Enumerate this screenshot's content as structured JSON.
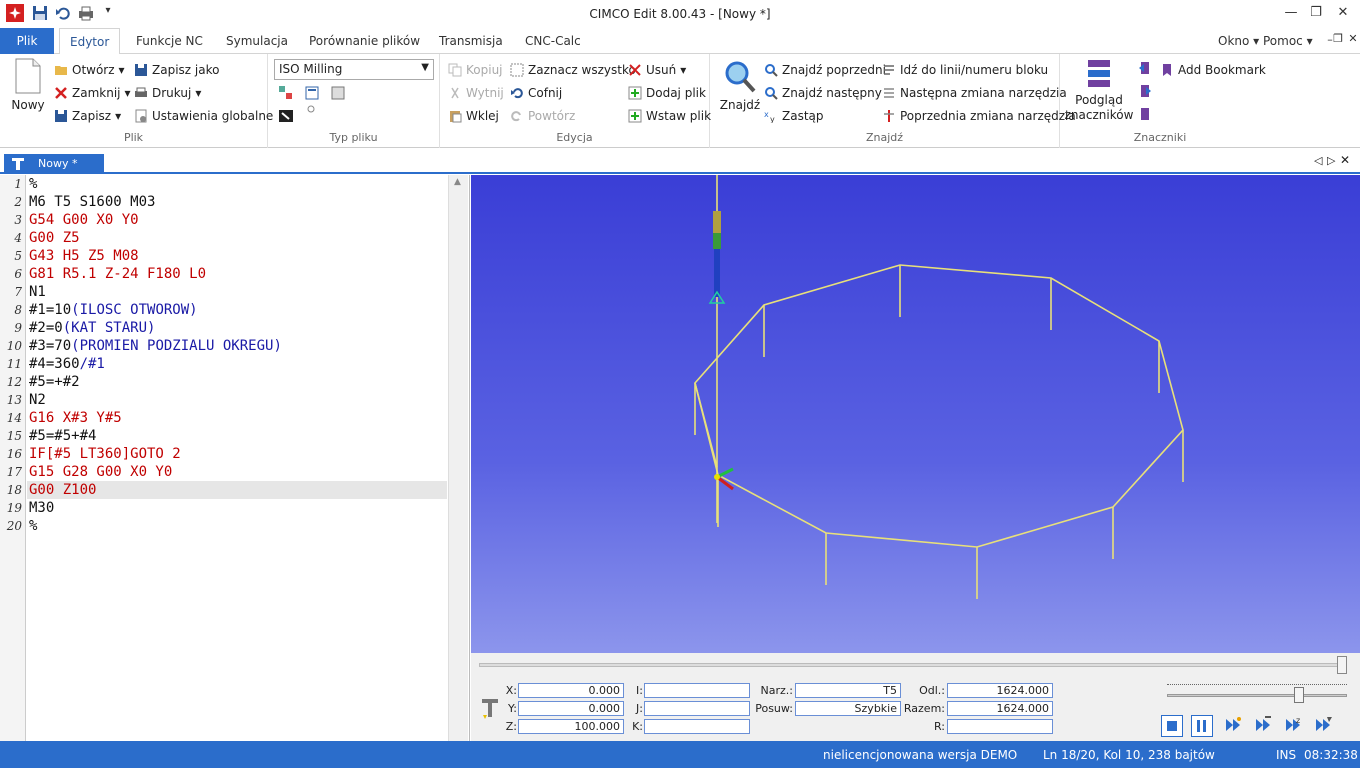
{
  "window": {
    "title": "CIMCO Edit 8.00.43 - [Nowy *]"
  },
  "tabs": [
    {
      "label": "Plik"
    },
    {
      "label": "Edytor"
    },
    {
      "label": "Funkcje NC"
    },
    {
      "label": "Symulacja"
    },
    {
      "label": "Porównanie plików"
    },
    {
      "label": "Transmisja"
    },
    {
      "label": "CNC-Calc"
    }
  ],
  "menu_right": {
    "okno": "Okno",
    "pomoc": "Pomoc"
  },
  "ribbon": {
    "plik": {
      "group": "Plik",
      "nowy": "Nowy",
      "otworz": "Otwórz",
      "zamknij": "Zamknij",
      "zapisz": "Zapisz",
      "zapisz_jako": "Zapisz jako",
      "drukuj": "Drukuj",
      "ustawienia": "Ustawienia globalne"
    },
    "typ": {
      "group": "Typ pliku",
      "selected": "ISO Milling"
    },
    "edycja": {
      "group": "Edycja",
      "kopiuj": "Kopiuj",
      "wytnij": "Wytnij",
      "wklej": "Wklej",
      "zaznacz": "Zaznacz wszystko",
      "cofnij": "Cofnij",
      "powtorz": "Powtórz",
      "usun": "Usuń",
      "dodaj": "Dodaj plik",
      "wstaw": "Wstaw plik"
    },
    "znajdz": {
      "group": "Znajdź",
      "znajdz": "Znajdź",
      "poprzedni": "Znajdź poprzedni",
      "nastepny": "Znajdź następny",
      "zastap": "Zastąp",
      "idz": "Idź do linii/numeru bloku",
      "nast_zm": "Następna zmiana narzędzia",
      "poprz_zm": "Poprzednia zmiana narzędzia"
    },
    "znaczniki": {
      "group": "Znaczniki",
      "podglad1": "Podgląd",
      "podglad2": "znaczników",
      "add": "Add Bookmark"
    }
  },
  "doc_tab": {
    "label": "Nowy *"
  },
  "colors": {
    "red": "#c00000",
    "blue": "#1a1aa6",
    "black": "#111111",
    "accent": "#2b6dcb",
    "path": "#e8e07a"
  },
  "code_lines": [
    {
      "n": "1",
      "parts": [
        {
          "t": "%",
          "c": "black"
        }
      ]
    },
    {
      "n": "2",
      "parts": [
        {
          "t": "M6 T5 S1600 M03",
          "c": "black"
        }
      ]
    },
    {
      "n": "3",
      "parts": [
        {
          "t": "G54 G00 X0 Y0",
          "c": "red"
        }
      ]
    },
    {
      "n": "4",
      "parts": [
        {
          "t": "G00 Z5",
          "c": "red"
        }
      ]
    },
    {
      "n": "5",
      "parts": [
        {
          "t": "G43 H5 Z5 M08",
          "c": "red"
        }
      ]
    },
    {
      "n": "6",
      "parts": [
        {
          "t": "G81 R5.1 Z-24 F180 L0",
          "c": "red"
        }
      ]
    },
    {
      "n": "7",
      "parts": [
        {
          "t": "N1",
          "c": "black"
        }
      ]
    },
    {
      "n": "8",
      "parts": [
        {
          "t": "#1=10",
          "c": "black"
        },
        {
          "t": "(ILOSC OTWOROW)",
          "c": "blue"
        }
      ]
    },
    {
      "n": "9",
      "parts": [
        {
          "t": "#2=0",
          "c": "black"
        },
        {
          "t": "(KAT STARU)",
          "c": "blue"
        }
      ]
    },
    {
      "n": "10",
      "parts": [
        {
          "t": "#3=70",
          "c": "black"
        },
        {
          "t": "(PROMIEN PODZIALU OKREGU)",
          "c": "blue"
        }
      ]
    },
    {
      "n": "11",
      "parts": [
        {
          "t": "#4=360",
          "c": "black"
        },
        {
          "t": "/#1",
          "c": "blue"
        }
      ]
    },
    {
      "n": "12",
      "parts": [
        {
          "t": "#5=+#2",
          "c": "black"
        }
      ]
    },
    {
      "n": "13",
      "parts": [
        {
          "t": "N2",
          "c": "black"
        }
      ]
    },
    {
      "n": "14",
      "parts": [
        {
          "t": "G16 X#3 Y#5",
          "c": "red"
        }
      ]
    },
    {
      "n": "15",
      "parts": [
        {
          "t": "#5=#5+#4",
          "c": "black"
        }
      ]
    },
    {
      "n": "16",
      "parts": [
        {
          "t": "IF[#5 LT360]GOTO 2",
          "c": "red"
        }
      ]
    },
    {
      "n": "17",
      "parts": [
        {
          "t": "G15 G28 G00 X0 Y0",
          "c": "red"
        }
      ]
    },
    {
      "n": "18",
      "parts": [
        {
          "t": "G00 Z100",
          "c": "red"
        }
      ],
      "current": true
    },
    {
      "n": "19",
      "parts": [
        {
          "t": "M30",
          "c": "black"
        }
      ]
    },
    {
      "n": "20",
      "parts": [
        {
          "t": "%",
          "c": "black"
        }
      ]
    }
  ],
  "sim": {
    "x_label": "X:",
    "x": "0.000",
    "y_label": "Y:",
    "y": "0.000",
    "z_label": "Z:",
    "z": "100.000",
    "i_label": "I:",
    "j_label": "J:",
    "k_label": "K:",
    "narz_label": "Narz.:",
    "narz": "T5",
    "posuw_label": "Posuw:",
    "posuw": "Szybkie",
    "odl_label": "Odl.:",
    "odl": "1624.000",
    "razem_label": "Razem:",
    "razem": "1624.000",
    "r_label": "R:"
  },
  "statusbar": {
    "license": "nielicencjonowana wersja DEMO",
    "pos": "Ln 18/20, Kol 10, 238 bajtów",
    "mode": "INS",
    "time": "08:32:38"
  }
}
